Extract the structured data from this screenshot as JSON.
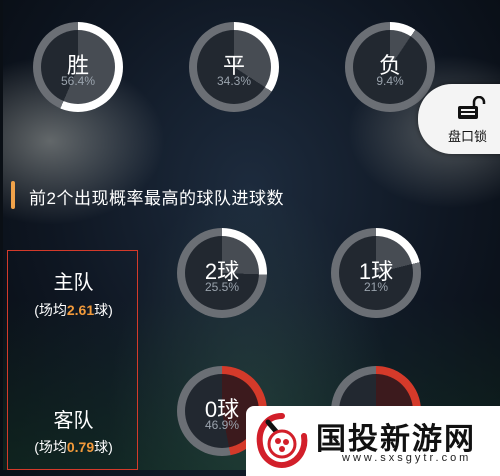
{
  "outcome_rings": [
    {
      "label": "胜",
      "pct": "56.4%",
      "fraction": 0.564
    },
    {
      "label": "平",
      "pct": "34.3%",
      "fraction": 0.343
    },
    {
      "label": "负",
      "pct": "9.4%",
      "fraction": 0.094
    }
  ],
  "lock_button": {
    "label": "盘口锁",
    "icon": "unlocked-padlock-icon"
  },
  "section": {
    "title": "前2个出现概率最高的球队进球数"
  },
  "home": {
    "name": "主队",
    "prefix": "(场均",
    "value": "2.61",
    "suffix": "球)"
  },
  "away": {
    "name": "客队",
    "prefix": "(场均",
    "value": "0.79",
    "suffix": "球)"
  },
  "home_goal_rings": [
    {
      "label": "2球",
      "pct": "25.5%",
      "fraction": 0.255
    },
    {
      "label": "1球",
      "pct": "21%",
      "fraction": 0.21
    }
  ],
  "away_goal_rings": [
    {
      "label": "0球",
      "pct": "46.9%",
      "fraction": 0.469
    },
    {
      "label": "",
      "pct": "",
      "fraction": 0.25
    }
  ],
  "watermark": {
    "title": "国投新游网",
    "url": "www.sxsgytr.com"
  },
  "colors": {
    "ring_fill": "#ffffff",
    "ring_track": "#6b6f75",
    "away_ring_fill": "#d43a2a",
    "accent": "#f29a3b",
    "section_bar": "#f0a24a",
    "team_border": "#d43a2a"
  }
}
